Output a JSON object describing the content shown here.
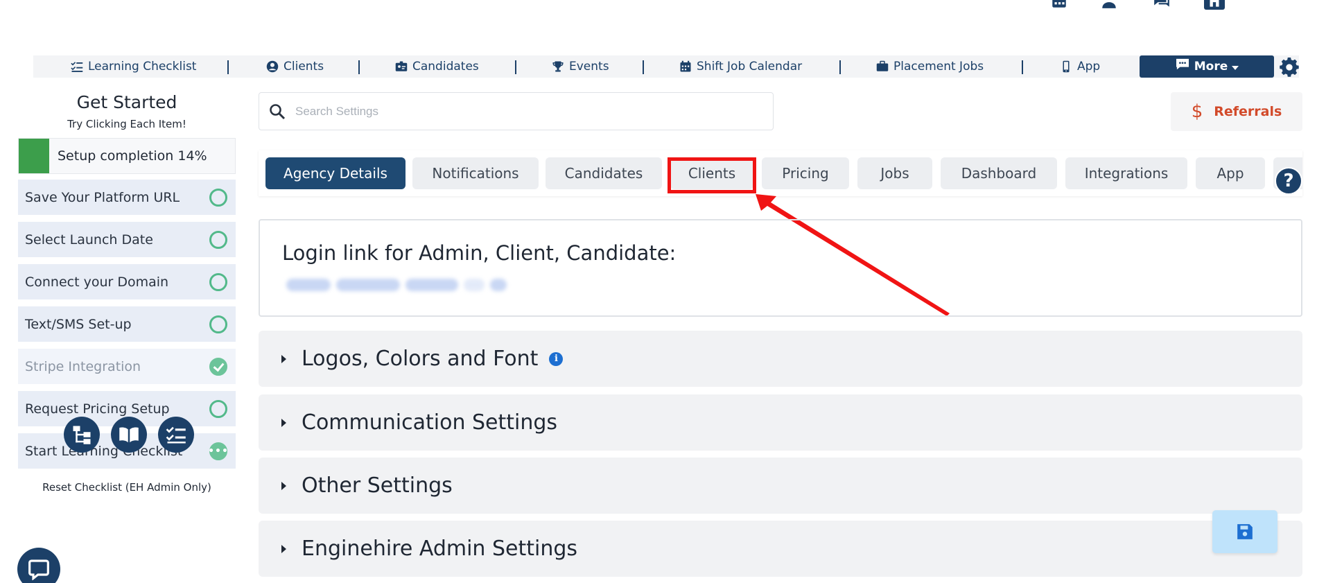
{
  "nav": {
    "items": [
      {
        "label": "Learning Checklist",
        "icon": "checklist-icon"
      },
      {
        "label": "Clients",
        "icon": "user-circle-icon"
      },
      {
        "label": "Candidates",
        "icon": "id-card-icon"
      },
      {
        "label": "Events",
        "icon": "trophy-icon"
      },
      {
        "label": "Shift Job Calendar",
        "icon": "calendar-icon"
      },
      {
        "label": "Placement Jobs",
        "icon": "briefcase-icon"
      },
      {
        "label": "App",
        "icon": "mobile-icon"
      }
    ],
    "more_label": "More"
  },
  "sidebar": {
    "title": "Get Started",
    "subtitle": "Try Clicking Each Item!",
    "progress_text": "Setup completion 14%",
    "progress_percent": 14,
    "steps": [
      {
        "label": "Save Your Platform URL",
        "status": "todo"
      },
      {
        "label": "Select Launch Date",
        "status": "todo"
      },
      {
        "label": "Connect your Domain",
        "status": "todo"
      },
      {
        "label": "Text/SMS Set-up",
        "status": "todo"
      },
      {
        "label": "Stripe Integration",
        "status": "done"
      },
      {
        "label": "Request Pricing Setup",
        "status": "todo"
      },
      {
        "label": "Start Learning Checklist",
        "status": "in-progress",
        "badge": "•••"
      }
    ],
    "reset_label": "Reset Checklist (EH Admin Only)"
  },
  "search": {
    "placeholder": "Search Settings"
  },
  "referrals": {
    "icon_text": "$",
    "label": "Referrals"
  },
  "tabs": [
    "Agency Details",
    "Notifications",
    "Candidates",
    "Clients",
    "Pricing",
    "Jobs",
    "Dashboard",
    "Integrations",
    "App"
  ],
  "active_tab": "Agency Details",
  "help_label": "?",
  "login": {
    "title": "Login link for Admin, Client, Candidate:"
  },
  "sections": [
    {
      "label": "Logos, Colors and Font",
      "info": "i"
    },
    {
      "label": "Communication Settings"
    },
    {
      "label": "Other Settings"
    },
    {
      "label": "Enginehire Admin Settings"
    }
  ],
  "colors": {
    "primary": "#1c4068",
    "accent": "#d24a2a",
    "success": "#52b98a",
    "highlight": "#f01414"
  }
}
